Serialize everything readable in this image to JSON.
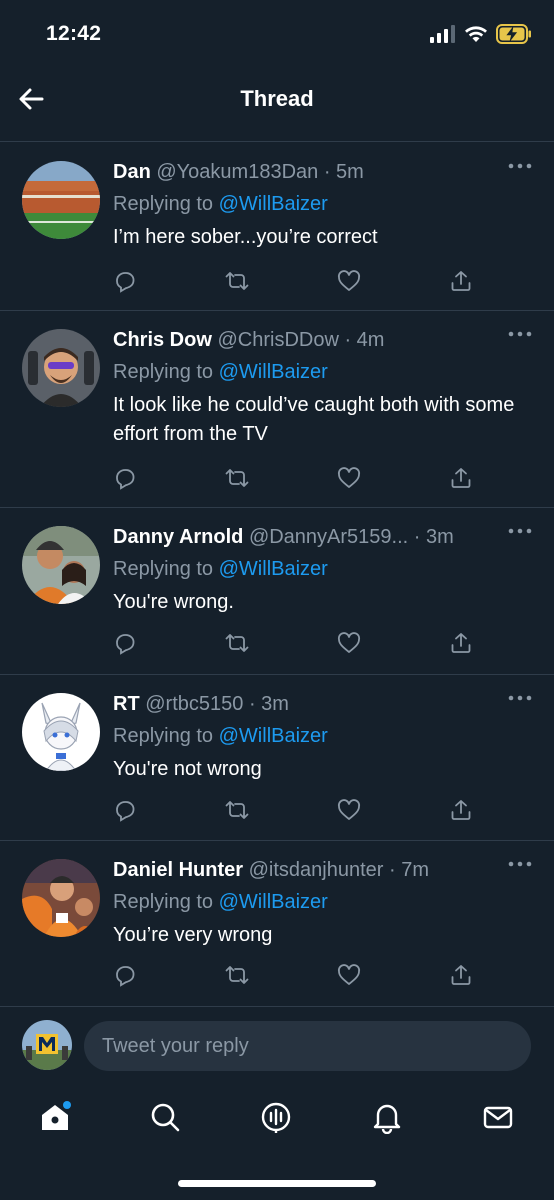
{
  "status_bar": {
    "time": "12:42"
  },
  "header": {
    "title": "Thread"
  },
  "tweets": [
    {
      "name": "Dan",
      "handle": "@Yoakum183Dan",
      "time": "· 5m",
      "replying_prefix": "Replying to",
      "mention": "@WillBaizer",
      "text": "I’m here sober...you’re correct"
    },
    {
      "name": "Chris Dow",
      "handle": "@ChrisDDow",
      "time": "· 4m",
      "replying_prefix": "Replying to",
      "mention": "@WillBaizer",
      "text": "It look like he could’ve caught both with some effort from the TV"
    },
    {
      "name": "Danny Arnold",
      "handle": "@DannyAr5159...",
      "time": "· 3m",
      "replying_prefix": "Replying to",
      "mention": "@WillBaizer",
      "text": "You're wrong."
    },
    {
      "name": "RT",
      "handle": "@rtbc5150",
      "time": "· 3m",
      "replying_prefix": "Replying to",
      "mention": "@WillBaizer",
      "text": "You're not wrong"
    },
    {
      "name": "Daniel Hunter",
      "handle": "@itsdanjhunter",
      "time": "· 7m",
      "replying_prefix": "Replying to",
      "mention": "@WillBaizer",
      "text": "You’re very wrong"
    }
  ],
  "reply_bar": {
    "placeholder": "Tweet your reply"
  },
  "tab_bar": {
    "items": [
      "home-icon",
      "search-icon",
      "spaces-icon",
      "notifications-icon",
      "messages-icon"
    ]
  },
  "colors": {
    "background": "#15202b",
    "accent": "#1d9bf0",
    "secondary_text": "#8b98a5",
    "divider": "#2f3c4a"
  }
}
